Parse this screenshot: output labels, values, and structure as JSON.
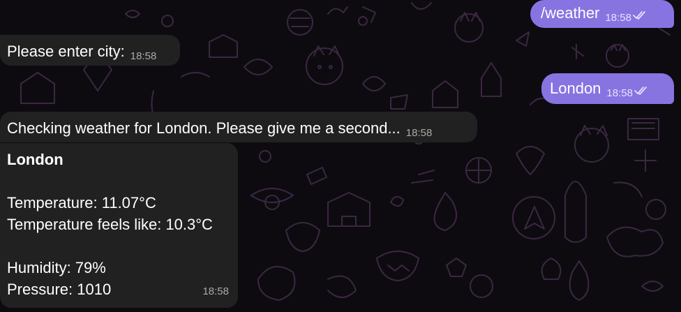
{
  "chat": {
    "messages": [
      {
        "text": "/weather",
        "time": "18:58",
        "direction": "outgoing",
        "status": "read-double-check-icon"
      },
      {
        "text": "Please enter city:",
        "time": "18:58",
        "direction": "incoming"
      },
      {
        "text": "London",
        "time": "18:58",
        "direction": "outgoing",
        "status": "read-double-check-icon"
      },
      {
        "text": "Checking weather for London. Please give me a second...",
        "time": "18:58",
        "direction": "incoming"
      }
    ],
    "weather_card": {
      "city": "London",
      "temperature": "Temperature: 11.07°C",
      "feels_like": "Temperature feels like: 10.3°C",
      "humidity": "Humidity: 79%",
      "pressure": "Pressure: 1010",
      "time": "18:58"
    }
  },
  "theme": {
    "background": "#0e0b10",
    "incoming_bubble": "#212121",
    "outgoing_bubble": "#8774e1",
    "wallpaper_pattern": "#3d2a45"
  }
}
